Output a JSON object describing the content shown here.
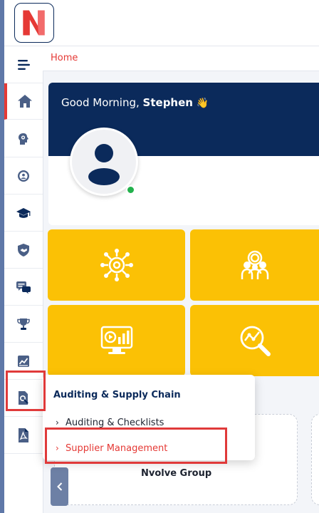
{
  "app": {
    "logo_letter": "N",
    "brand_color": "#e53935",
    "navy": "#0b2a5b",
    "tile_color": "#fbc105"
  },
  "breadcrumb": {
    "home": "Home"
  },
  "welcome": {
    "greeting": "Good Morning,",
    "user_name": "Stephen",
    "wave_emoji": "👋",
    "status": "online"
  },
  "sidebar": {
    "items": [
      {
        "icon": "hamburger-icon"
      },
      {
        "icon": "home-icon",
        "active": true
      },
      {
        "icon": "brain-gear-icon"
      },
      {
        "icon": "person-gear-icon"
      },
      {
        "icon": "graduation-cap-icon"
      },
      {
        "icon": "shield-handshake-icon"
      },
      {
        "icon": "chat-bubbles-icon"
      },
      {
        "icon": "trophy-icon"
      },
      {
        "icon": "chart-doc-icon"
      },
      {
        "icon": "audit-search-icon",
        "highlighted": true
      },
      {
        "icon": "pdf-doc-icon"
      }
    ]
  },
  "tiles": [
    {
      "icon": "network-gear-icon"
    },
    {
      "icon": "team-gear-icon"
    },
    {
      "icon": "monitor-video-icon"
    },
    {
      "icon": "analytics-search-icon"
    }
  ],
  "flyout": {
    "title": "Auditing & Supply Chain",
    "items": [
      {
        "label": "Auditing & Checklists",
        "color": "#1d2330"
      },
      {
        "label": "Supplier Management",
        "color": "#e53935",
        "highlighted": true
      }
    ]
  },
  "card": {
    "label": "Nvolve Group"
  },
  "collapse": {
    "icon": "chevron-left-icon"
  }
}
